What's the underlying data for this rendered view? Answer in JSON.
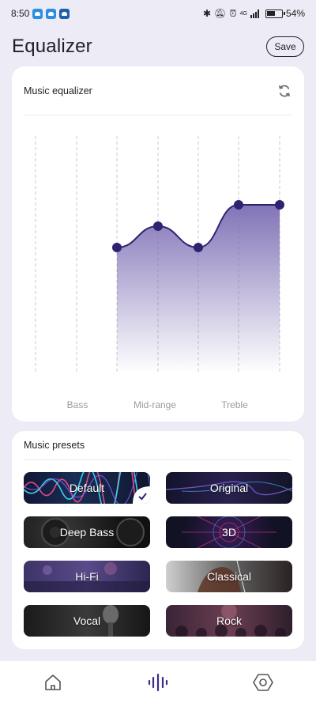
{
  "status_bar": {
    "time": "8:50",
    "network": "4G",
    "battery_percent": "54%"
  },
  "header": {
    "title": "Equalizer",
    "save_label": "Save"
  },
  "equalizer": {
    "title": "Music equalizer",
    "reset_icon": "refresh-icon",
    "band_labels": [
      "Bass",
      "Mid-range",
      "Treble"
    ],
    "points": [
      {
        "band": 2,
        "level": 0.53
      },
      {
        "band": 3,
        "level": 0.62
      },
      {
        "band": 4,
        "level": 0.53
      },
      {
        "band": 5,
        "level": 0.71
      },
      {
        "band": 6,
        "level": 0.71
      }
    ],
    "accent_color": "#2f2370",
    "fill_color": "#7b6cb3"
  },
  "presets": {
    "title": "Music presets",
    "items": [
      {
        "label": "Default",
        "selected": true
      },
      {
        "label": "Original",
        "selected": false
      },
      {
        "label": "Deep Bass",
        "selected": false
      },
      {
        "label": "3D",
        "selected": false
      },
      {
        "label": "Hi-Fi",
        "selected": false
      },
      {
        "label": "Classical",
        "selected": false
      },
      {
        "label": "Vocal",
        "selected": false
      },
      {
        "label": "Rock",
        "selected": false
      }
    ]
  },
  "bottom_nav": {
    "items": [
      {
        "icon": "home-icon",
        "active": false
      },
      {
        "icon": "equalizer-icon",
        "active": true
      },
      {
        "icon": "hexagon-settings-icon",
        "active": false
      }
    ],
    "active_color": "#3a2d86",
    "inactive_color": "#555"
  }
}
